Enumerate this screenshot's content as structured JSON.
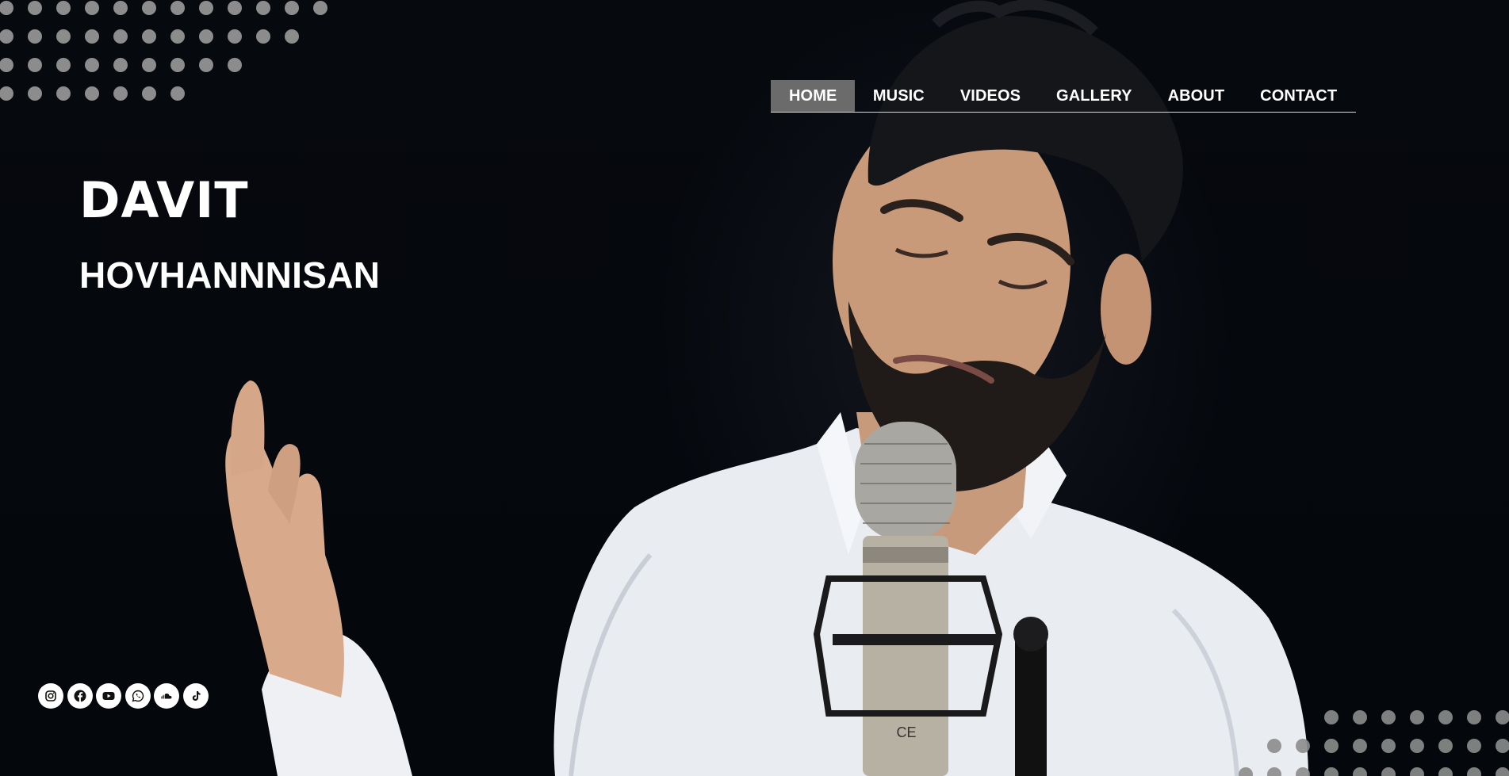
{
  "nav": {
    "items": [
      {
        "label": "HOME",
        "active": true
      },
      {
        "label": "MUSIC"
      },
      {
        "label": "VIDEOS"
      },
      {
        "label": "GALLERY"
      },
      {
        "label": "ABOUT"
      },
      {
        "label": "CONTACT"
      }
    ]
  },
  "hero": {
    "first_name": "DAVIT",
    "last_name": "HOVHANNNISAN"
  },
  "social": [
    {
      "icon": "instagram-icon"
    },
    {
      "icon": "facebook-icon"
    },
    {
      "icon": "youtube-icon"
    },
    {
      "icon": "whatsapp-icon"
    },
    {
      "icon": "soundcloud-icon"
    },
    {
      "icon": "tiktok-icon"
    }
  ],
  "colors": {
    "background": "#05080d",
    "nav_active": "#6b6b6b",
    "dots": "#8c8c8c",
    "text": "#ffffff"
  }
}
